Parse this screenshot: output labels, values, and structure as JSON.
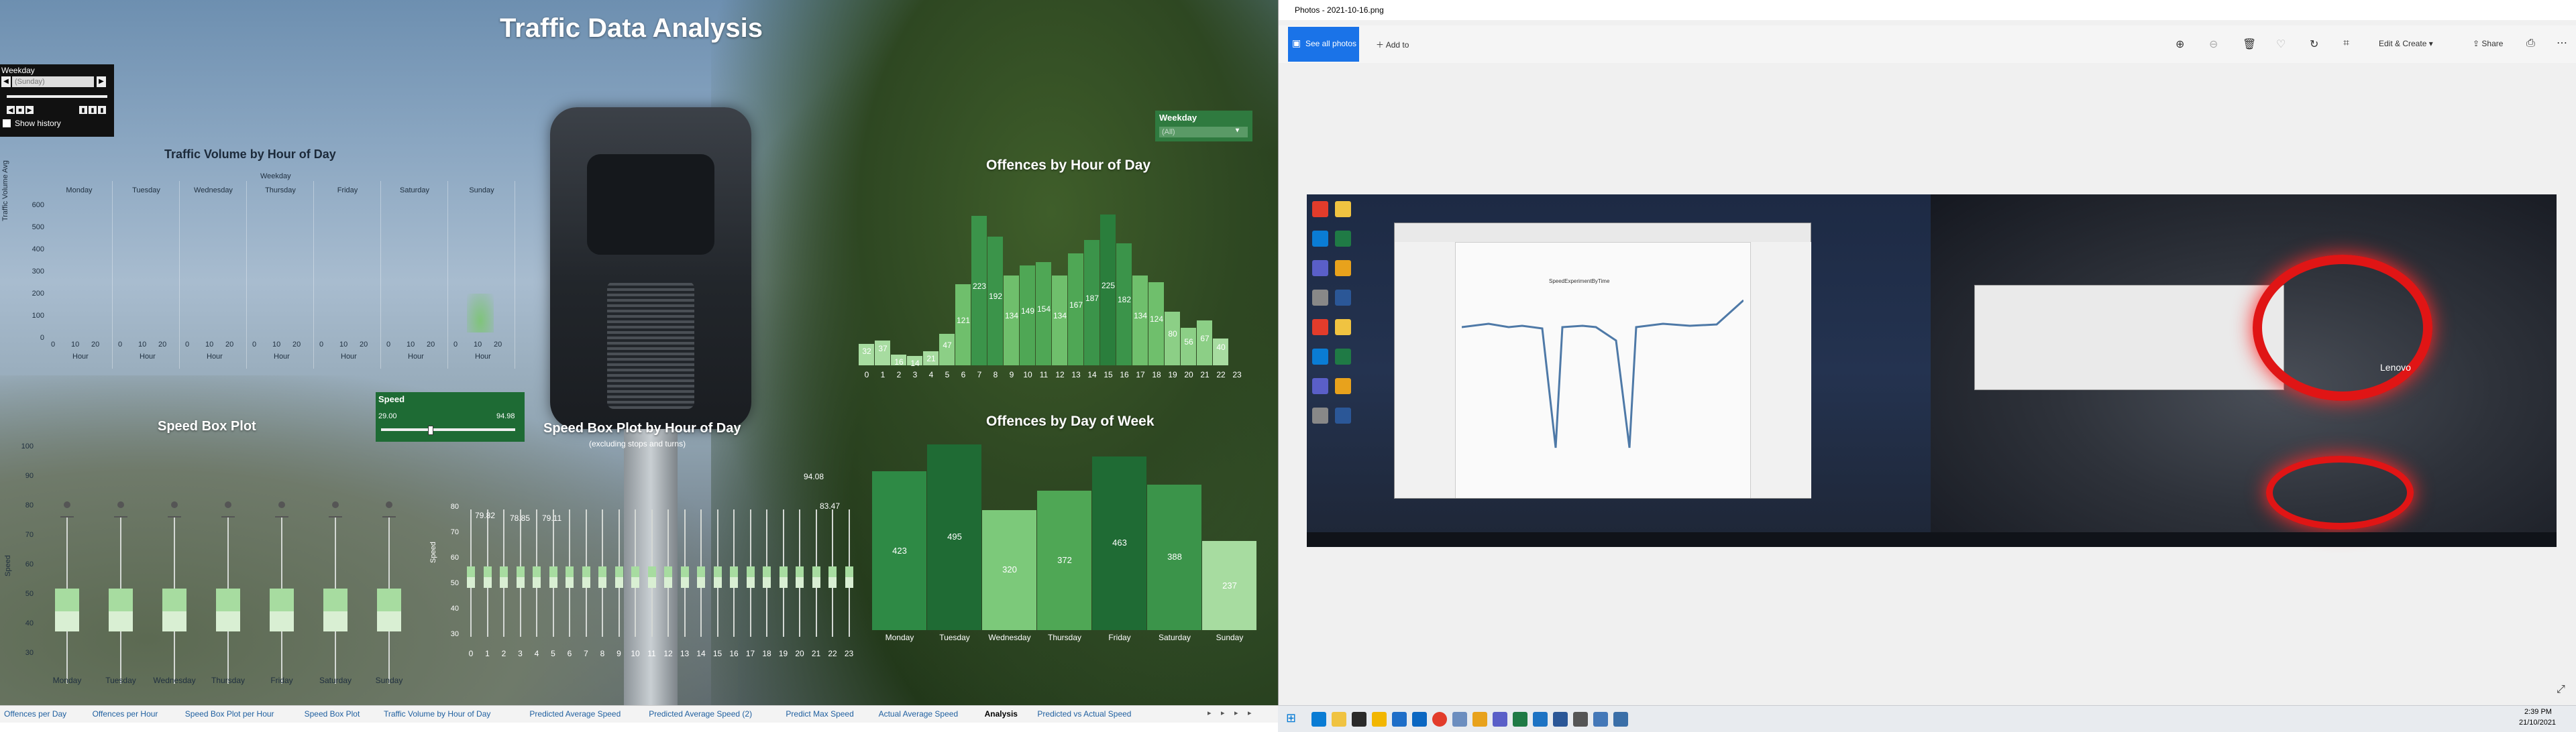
{
  "dashboard": {
    "title": "Traffic Data Analysis",
    "filter_widget": {
      "title": "Weekday",
      "value": "(Sunday)",
      "show_history": "Show history"
    },
    "weekday_filter": {
      "title": "Weekday",
      "value": "(All)"
    },
    "speed_filter": {
      "title": "Speed",
      "min": "29.00",
      "max": "94.98"
    },
    "volume_chart": {
      "title": "Traffic Volume by Hour of Day",
      "header": "Weekday",
      "ylabel": "Traffic Volume Avg",
      "yticks": [
        "600",
        "500",
        "400",
        "300",
        "200",
        "100",
        "0"
      ],
      "days": [
        "Monday",
        "Tuesday",
        "Wednesday",
        "Thursday",
        "Friday",
        "Saturday",
        "Sunday"
      ],
      "xticks": [
        "0",
        "10",
        "20"
      ],
      "xlabel": "Hour"
    },
    "box_day": {
      "title": "Speed  Box Plot",
      "ylabel": "Speed",
      "yticks": [
        "100",
        "90",
        "80",
        "70",
        "60",
        "50",
        "40",
        "30"
      ],
      "days": [
        "Monday",
        "Tuesday",
        "Wednesday",
        "Thursday",
        "Friday",
        "Saturday",
        "Sunday"
      ]
    },
    "box_hour": {
      "title": "Speed  Box Plot by Hour of Day",
      "subtitle": "(excluding stops and turns)",
      "ylabel": "Speed",
      "yticks": [
        "80",
        "70",
        "60",
        "50",
        "40",
        "30"
      ],
      "hours": [
        "0",
        "1",
        "2",
        "3",
        "4",
        "5",
        "6",
        "7",
        "8",
        "9",
        "10",
        "11",
        "12",
        "13",
        "14",
        "15",
        "16",
        "17",
        "18",
        "19",
        "20",
        "21",
        "22",
        "23"
      ],
      "annotations": [
        "79.82",
        "78.85",
        "79.11",
        "94.08",
        "83.47"
      ]
    },
    "offences_hour": {
      "title": "Offences by Hour of Day",
      "hours": [
        "0",
        "1",
        "2",
        "3",
        "4",
        "5",
        "6",
        "7",
        "8",
        "9",
        "10",
        "11",
        "12",
        "13",
        "14",
        "15",
        "16",
        "17",
        "18",
        "19",
        "20",
        "21",
        "22",
        "23"
      ],
      "values": [
        32,
        37,
        16,
        14,
        21,
        47,
        121,
        223,
        192,
        134,
        149,
        154,
        134,
        167,
        187,
        225,
        182,
        134,
        124,
        80,
        56,
        67,
        40,
        null
      ],
      "labels": [
        "32",
        "37",
        "16",
        "14",
        "21",
        "47",
        "121",
        "223",
        "192",
        "134",
        "149",
        "154",
        "134",
        "167",
        "187",
        "225",
        "182",
        "134",
        "124",
        "80",
        "56",
        "67",
        "40",
        ""
      ]
    },
    "offences_week": {
      "title": "Offences by Day of Week",
      "days": [
        "Monday",
        "Tuesday",
        "Wednesday",
        "Thursday",
        "Friday",
        "Saturday",
        "Sunday"
      ],
      "values": [
        423,
        495,
        320,
        372,
        463,
        388,
        237
      ],
      "labels": [
        "423",
        "495",
        "320",
        "372",
        "463",
        "388",
        "237"
      ]
    },
    "tabs": [
      "Offences per Day",
      "Offences per Hour",
      "Speed Box Plot per Hour",
      "Speed Box Plot",
      "Traffic Volume by Hour of Day",
      "Predicted Average Speed",
      "Predicted Average Speed (2)",
      "Predict Max Speed",
      "Actual Average Speed",
      "Analysis",
      "Predicted vs Actual Speed"
    ],
    "active_tab": "Analysis"
  },
  "photos": {
    "title": "Photos - 2021-10-16.png",
    "see_all": "See all photos",
    "add_to": "Add to",
    "edit_create": "Edit & Create",
    "share": "Share",
    "inner_chart_title": "SpeedExperimentByTime",
    "lenovo": "Lenovo"
  },
  "taskbar": {
    "time": "2:39 PM",
    "date": "21/10/2021"
  },
  "chart_data": [
    {
      "type": "bar",
      "title": "Offences by Hour of Day",
      "categories": [
        "0",
        "1",
        "2",
        "3",
        "4",
        "5",
        "6",
        "7",
        "8",
        "9",
        "10",
        "11",
        "12",
        "13",
        "14",
        "15",
        "16",
        "17",
        "18",
        "19",
        "20",
        "21",
        "22"
      ],
      "values": [
        32,
        37,
        16,
        14,
        21,
        47,
        121,
        223,
        192,
        134,
        149,
        154,
        134,
        167,
        187,
        225,
        182,
        134,
        124,
        80,
        56,
        67,
        40
      ]
    },
    {
      "type": "bar",
      "title": "Offences by Day of Week",
      "categories": [
        "Monday",
        "Tuesday",
        "Wednesday",
        "Thursday",
        "Friday",
        "Saturday",
        "Sunday"
      ],
      "values": [
        423,
        495,
        320,
        372,
        463,
        388,
        237
      ]
    }
  ],
  "colors": {
    "accent_green": "#2f7a3f",
    "light_green": "#a7dca0",
    "dark_green": "#1f6b34",
    "photos_blue": "#1a73e8"
  }
}
